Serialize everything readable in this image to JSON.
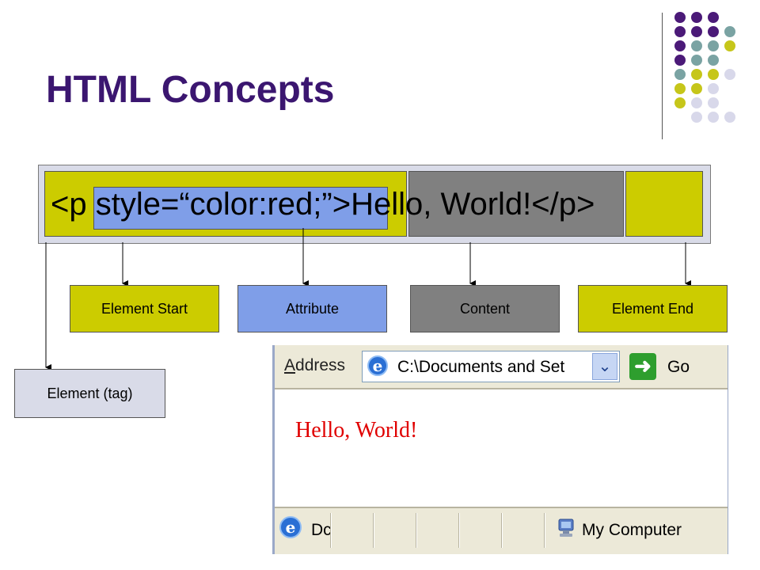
{
  "slide": {
    "title": "HTML Concepts"
  },
  "code": {
    "tag_open": "<p ",
    "attribute": "style=“color:red;”",
    "tag_close_bracket": ">",
    "content": "Hello, World!",
    "end_tag": "</p>"
  },
  "labels": {
    "element_start": "Element Start",
    "attribute": "Attribute",
    "content": "Content",
    "element_end": "Element End",
    "element_tag": "Element (tag)"
  },
  "browser": {
    "address_label_prefix": "A",
    "address_label_rest": "ddress",
    "address_value": "C:\\Documents and Set",
    "go_label": "Go",
    "page_text": "Hello, World!",
    "status_text": "Dc",
    "zone_text": "My Computer"
  },
  "colors": {
    "title": "#3b1670",
    "element": "#cccc00",
    "attribute": "#7f9ee8",
    "content": "#808080",
    "tag_box": "#d9dbe8",
    "page_text": "#e00000"
  },
  "icons": {
    "address_icon": "ie-page-icon",
    "dropdown": "chevron-down-icon",
    "go": "go-arrow-icon",
    "status_icon": "ie-page-icon",
    "zone_icon": "computer-icon"
  }
}
